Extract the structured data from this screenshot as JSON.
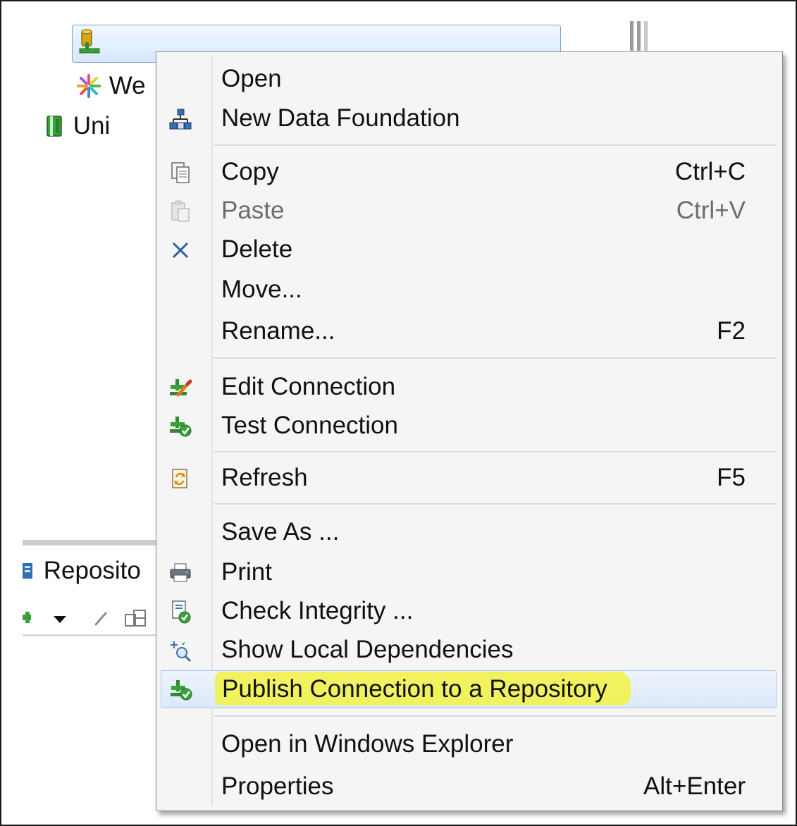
{
  "tree": {
    "selected_item_icon": "database-connection-icon",
    "rows": [
      {
        "label": "We",
        "icon": "star-cluster-icon"
      },
      {
        "label": "Uni",
        "icon": "book-icon"
      }
    ]
  },
  "repository_panel": {
    "tab_label": "Reposito",
    "tab_icon": "repository-icon"
  },
  "context_menu": {
    "highlight_color": "#f2f24d",
    "items": [
      {
        "label": "Open",
        "shortcut": "",
        "icon": ""
      },
      {
        "label": "New Data Foundation",
        "shortcut": "",
        "icon": "data-foundation-icon"
      },
      {
        "label": "Copy",
        "shortcut": "Ctrl+C",
        "icon": "copy-icon"
      },
      {
        "label": "Paste",
        "shortcut": "Ctrl+V",
        "icon": "paste-icon",
        "disabled": true
      },
      {
        "label": "Delete",
        "shortcut": "",
        "icon": "delete-icon"
      },
      {
        "label": "Move...",
        "shortcut": "",
        "icon": ""
      },
      {
        "label": "Rename...",
        "shortcut": "F2",
        "icon": ""
      },
      {
        "label": "Edit Connection",
        "shortcut": "",
        "icon": "edit-connection-icon"
      },
      {
        "label": "Test Connection",
        "shortcut": "",
        "icon": "test-connection-icon"
      },
      {
        "label": "Refresh",
        "shortcut": "F5",
        "icon": "refresh-icon"
      },
      {
        "label": "Save As ...",
        "shortcut": "",
        "icon": ""
      },
      {
        "label": "Print",
        "shortcut": "",
        "icon": "print-icon"
      },
      {
        "label": "Check Integrity ...",
        "shortcut": "",
        "icon": "check-integrity-icon"
      },
      {
        "label": "Show Local Dependencies",
        "shortcut": "",
        "icon": "dependencies-icon"
      },
      {
        "label": "Publish Connection to a Repository",
        "shortcut": "",
        "icon": "publish-connection-icon",
        "highlighted": true
      },
      {
        "label": "Open in Windows Explorer",
        "shortcut": "",
        "icon": ""
      },
      {
        "label": "Properties",
        "shortcut": "Alt+Enter",
        "icon": ""
      }
    ]
  }
}
